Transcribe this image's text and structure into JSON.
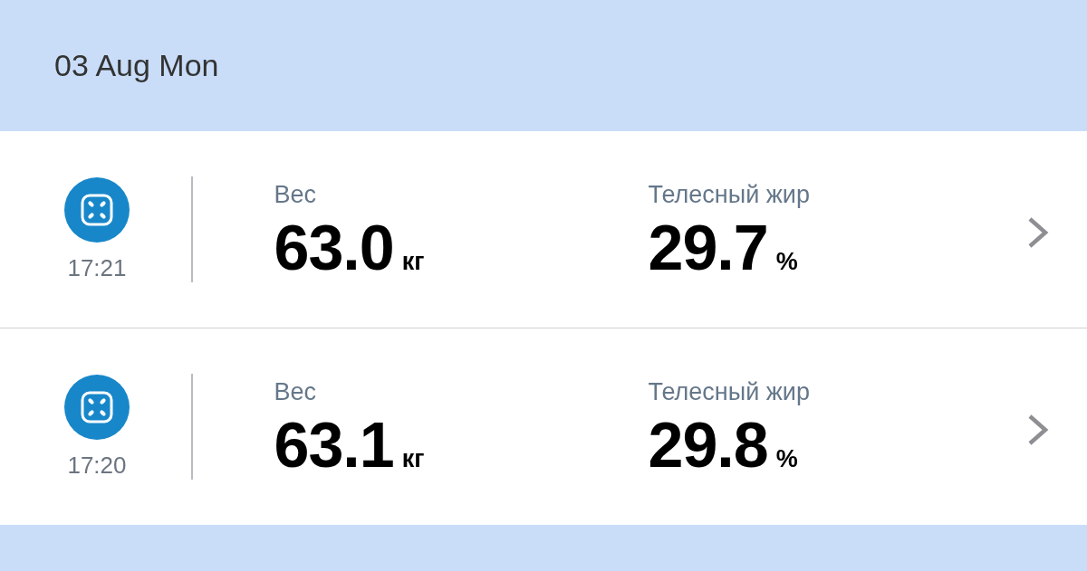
{
  "header": {
    "date": "03 Aug Mon"
  },
  "entries": [
    {
      "time": "17:21",
      "metrics": [
        {
          "label": "Вес",
          "value": "63.0",
          "unit": "кг"
        },
        {
          "label": "Телесный жир",
          "value": "29.7",
          "unit": "%"
        }
      ]
    },
    {
      "time": "17:20",
      "metrics": [
        {
          "label": "Вес",
          "value": "63.1",
          "unit": "кг"
        },
        {
          "label": "Телесный жир",
          "value": "29.8",
          "unit": "%"
        }
      ]
    }
  ]
}
